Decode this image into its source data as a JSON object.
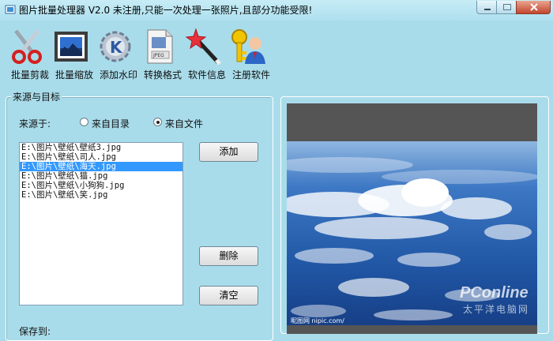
{
  "window": {
    "title": "图片批量处理器 V2.0  未注册,只能一次处理一张照片,且部分功能受限!"
  },
  "toolbar": [
    {
      "label": "批量剪裁",
      "icon": "scissors-icon"
    },
    {
      "label": "批量缩放",
      "icon": "photo-resize-icon"
    },
    {
      "label": "添加水印",
      "icon": "watermark-gear-icon"
    },
    {
      "label": "转换格式",
      "icon": "jpeg-file-icon"
    },
    {
      "label": "软件信息",
      "icon": "magic-wand-icon"
    },
    {
      "label": "注册软件",
      "icon": "key-user-icon"
    }
  ],
  "source_panel": {
    "title": "来源与目标",
    "source_label": "来源于:",
    "options": [
      {
        "label": "来自目录",
        "selected": false
      },
      {
        "label": "来自文件",
        "selected": true
      }
    ],
    "files": [
      "E:\\图片\\壁纸\\壁纸3.jpg",
      "E:\\图片\\壁纸\\司人.jpg",
      "E:\\图片\\壁纸\\海天.jpg",
      "E:\\图片\\壁纸\\猫.jpg",
      "E:\\图片\\壁纸\\小狗狗.jpg",
      "E:\\图片\\壁纸\\笑.jpg"
    ],
    "selected_index": 2,
    "add_label": "添加",
    "delete_label": "删除",
    "clear_label": "清空",
    "save_label": "保存到:"
  },
  "preview": {
    "watermark_brand": "PConline",
    "watermark_cn": "太平洋电脑网",
    "credit": "昵图网 nipic.com/"
  },
  "colors": {
    "window_bg": "#a9dcea",
    "selection": "#3399ff",
    "preview_bg": "#555555"
  }
}
